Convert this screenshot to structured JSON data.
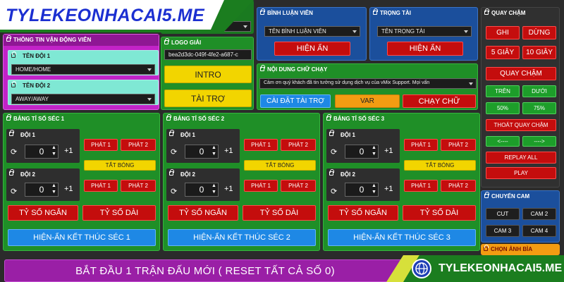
{
  "brand": {
    "site": "TYLEKEONHACAI5.ME",
    "footer_site": "TYLEKEONHACAI5.ME"
  },
  "players": {
    "title": "THÔNG TIN VẬN ĐỘNG VIÊN",
    "team1_label": "TÊN ĐỘI 1",
    "team1_value": "HOME/HOME",
    "team2_label": "TÊN ĐỘI 2",
    "team2_value": "AWAY/AWAY"
  },
  "logo": {
    "title": "LOGO GIẢI",
    "value": "bea2d3dc-049f-4fe2-a687-c",
    "intro": "INTRO",
    "sponsor": "TÀI TRỢ"
  },
  "commentator": {
    "title": "BÌNH LUẬN VIÊN",
    "select": "TÊN BÌNH LUẬN VIÊN",
    "toggle": "HIỆN ẨN"
  },
  "referee": {
    "title": "TRỌNG TÀI",
    "select": "TÊN TRỌNG TÀI",
    "toggle": "HIỆN ẨN"
  },
  "ticker": {
    "title": "NỘI DUNG CHỮ CHẠY",
    "text": "Cảm ơn quý khách đã tin tưởng sử dụng dịch vụ của vMix Support. Mọi vấn",
    "setup": "CÀI ĐẶT TÀI TRỢ",
    "var": "VAR",
    "run": "CHẠY CHỮ"
  },
  "slowmo": {
    "title": "QUAY CHẬM",
    "record": "GHI",
    "stop": "DỪNG",
    "s5": "5 GIÂY",
    "s10": "10 GIÂY",
    "replay": "QUAY CHẬM",
    "top": "TRÊN",
    "bottom": "DƯỚI",
    "p50": "50%",
    "p75": "75%",
    "exit": "THOÁT QUAY CHẬM",
    "prev": "<----",
    "next": "---->",
    "replay_all": "REPLAY ALL",
    "play": "PLAY"
  },
  "cam": {
    "title": "CHUYỂN CAM",
    "cut": "CUT",
    "cam2": "CAM 2",
    "cam3": "CAM 3",
    "cam4": "CAM 4",
    "cover": "CHỌN ẢNH BÌA"
  },
  "sets": [
    {
      "title": "BẢNG TỈ SỐ SÉC 1",
      "team1": "ĐỘI 1",
      "team2": "ĐỘI 2",
      "score1": "0",
      "score2": "0",
      "plus": "+1",
      "serve1": "PHÁT 1",
      "serve2": "PHÁT 2",
      "mute": "TẮT BÓNG",
      "short": "TỶ SỐ NGẮN",
      "long": "TỶ SỐ DÀI",
      "end": "HIỆN-ẨN KẾT THÚC SÉC 1"
    },
    {
      "title": "BẢNG TỈ SỐ SÉC 2",
      "team1": "ĐỘI 1",
      "team2": "ĐỘI 2",
      "score1": "0",
      "score2": "0",
      "plus": "+1",
      "serve1": "PHÁT 1",
      "serve2": "PHÁT 2",
      "mute": "TẮT BÓNG",
      "short": "TỶ SỐ NGẮN",
      "long": "TỶ SỐ DÀI",
      "end": "HIỆN-ẨN KẾT THÚC SÉC 2"
    },
    {
      "title": "BẢNG TỈ SỐ SÉC 3",
      "team1": "ĐỘI 1",
      "team2": "ĐỘI 2",
      "score1": "0",
      "score2": "0",
      "plus": "+1",
      "serve1": "PHÁT 1",
      "serve2": "PHÁT 2",
      "mute": "TẮT BÓNG",
      "short": "TỶ SỐ NGẮN",
      "long": "TỶ SỐ DÀI",
      "end": "HIỆN-ẨN KẾT THÚC SÉC 3"
    }
  ],
  "newmatch": "BẮT ĐẦU 1 TRẬN ĐẤU MỚI ( RESET TẤT CẢ SỐ 0)"
}
